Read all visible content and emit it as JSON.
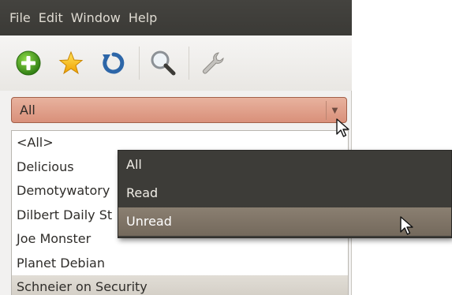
{
  "menubar": {
    "items": [
      "File",
      "Edit",
      "Window",
      "Help"
    ]
  },
  "toolbar": {
    "buttons": [
      {
        "icon": "add-icon",
        "color": "#3f9b1f"
      },
      {
        "icon": "star-icon",
        "color": "#f5b800"
      },
      {
        "icon": "refresh-icon",
        "color": "#2d66a8"
      },
      {
        "icon": "search-icon"
      },
      {
        "icon": "wrench-icon"
      }
    ]
  },
  "filter": {
    "selected": "All"
  },
  "feeds": [
    "<All>",
    "Delicious",
    "Demotywatory",
    "Dilbert Daily St",
    "Joe Monster",
    "Planet Debian",
    "Schneier on Security"
  ],
  "popup": {
    "options": [
      "All",
      "Read",
      "Unread"
    ],
    "hovered": "Unread"
  },
  "colors": {
    "menubar": "#3b3a36",
    "combo": "#d9907a",
    "popup": "#3d3c38"
  }
}
